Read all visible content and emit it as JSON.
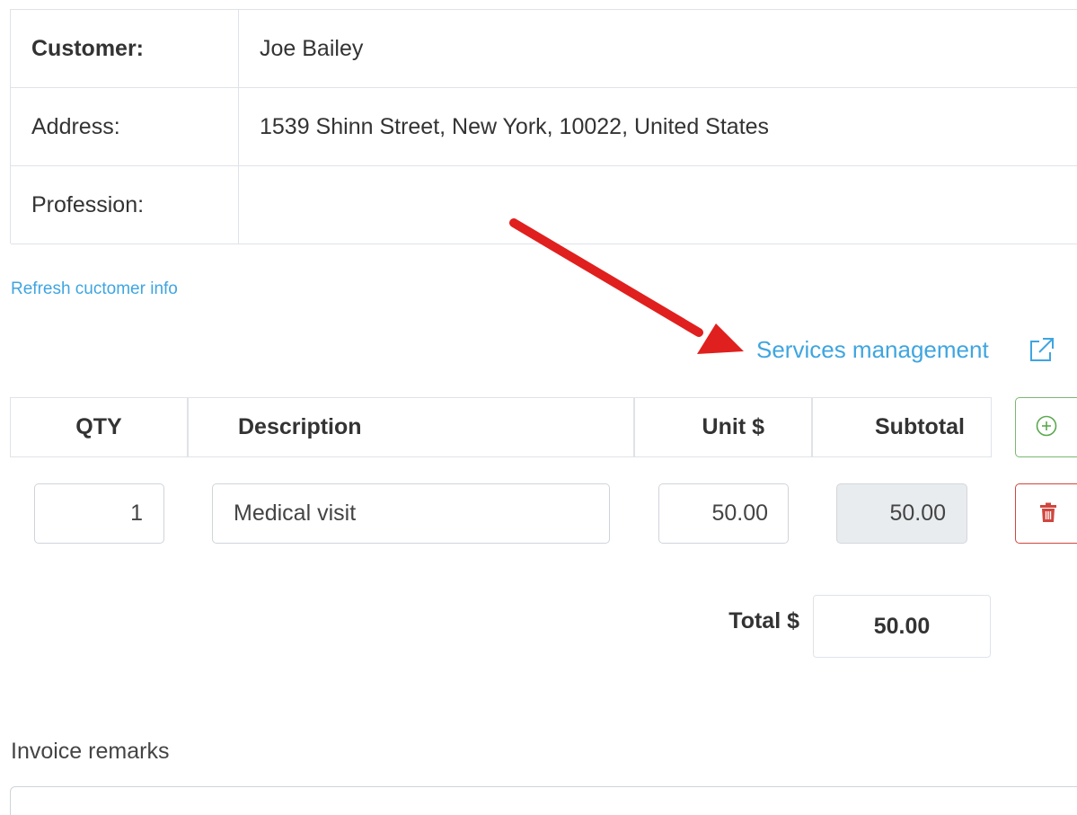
{
  "customer": {
    "rows": [
      {
        "label": "Customer:",
        "value": "Joe Bailey"
      },
      {
        "label": "Address:",
        "value": "1539 Shinn Street, New York, 10022, United States"
      },
      {
        "label": "Profession:",
        "value": ""
      }
    ],
    "refresh_link": "Refresh cuctomer info"
  },
  "services_link": {
    "label": "Services management",
    "icon": "external-link-icon"
  },
  "annotation": {
    "arrow_color": "#e0201e",
    "arrow_icon": "red-arrow-annotation"
  },
  "items": {
    "headers": {
      "qty": "QTY",
      "description": "Description",
      "unit": "Unit $",
      "subtotal": "Subtotal"
    },
    "add_icon": "plus-circle-icon",
    "delete_icon": "trash-icon",
    "rows": [
      {
        "qty": "1",
        "description": "Medical visit",
        "unit": "50.00",
        "subtotal": "50.00"
      }
    ]
  },
  "total": {
    "label": "Total $",
    "value": "50.00"
  },
  "remarks": {
    "label": "Invoice remarks",
    "value": ""
  },
  "colors": {
    "link": "#3fa5e0",
    "add_border": "#7ab870",
    "delete_border": "#d0463f",
    "annotation": "#e0201e"
  }
}
